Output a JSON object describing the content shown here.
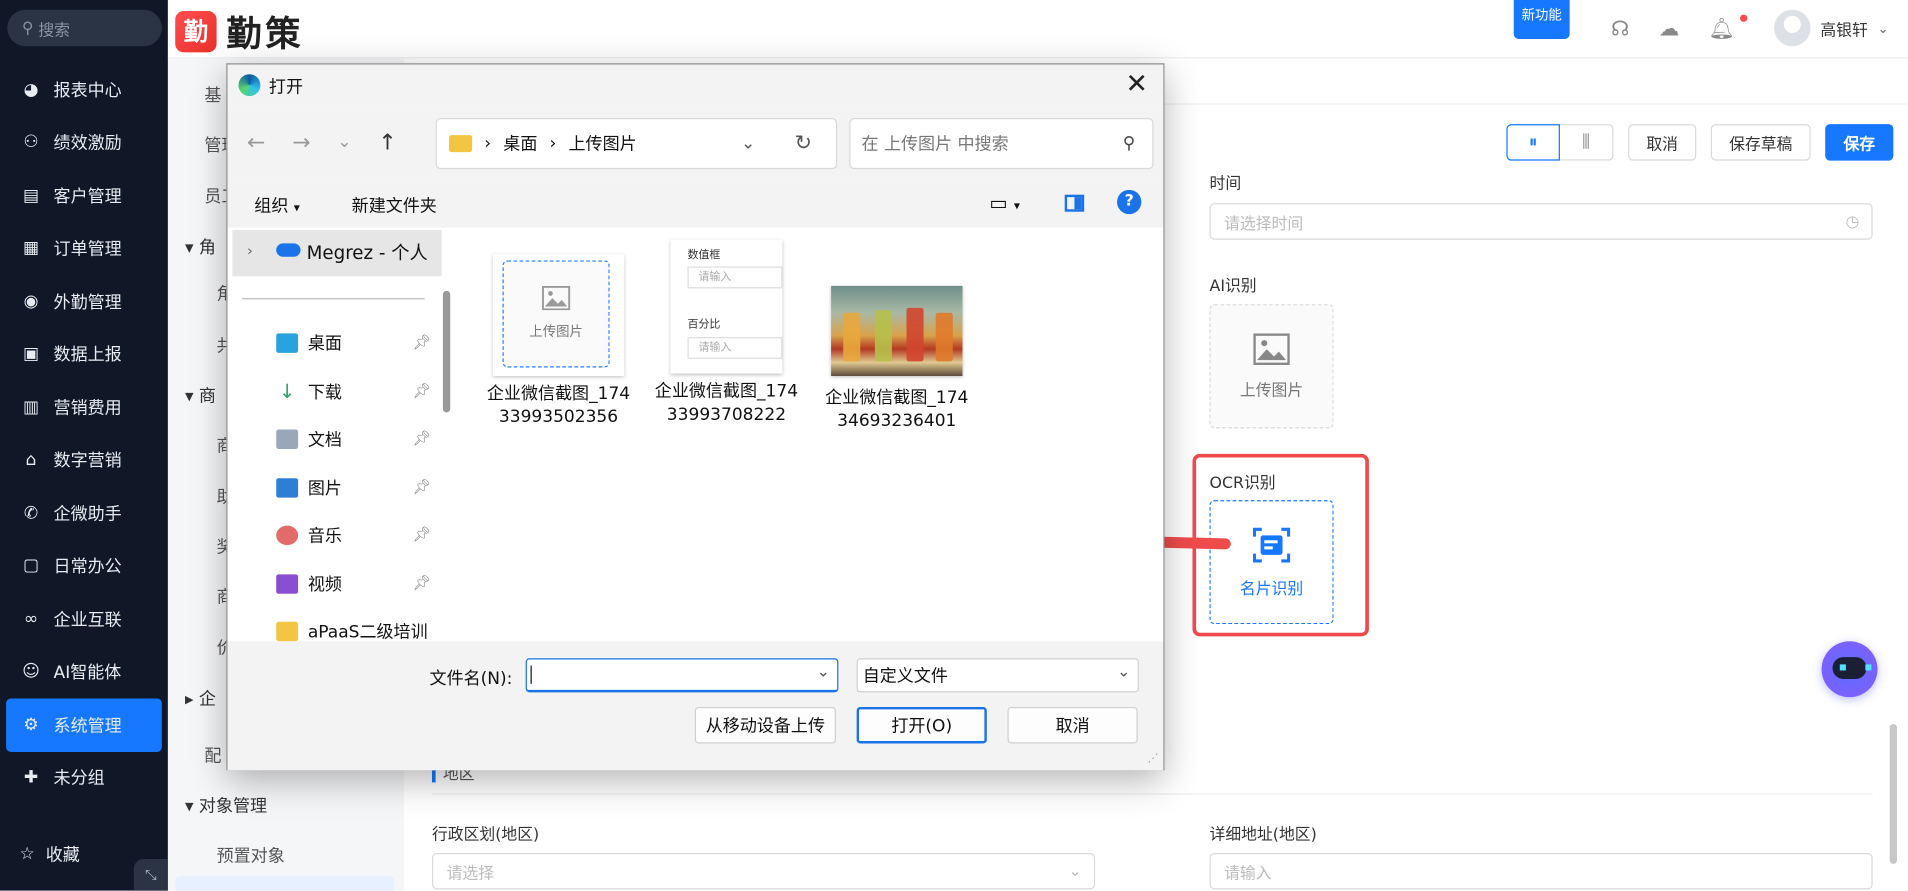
{
  "search": {
    "placeholder": "搜索"
  },
  "nav": [
    {
      "label": "报表中心",
      "icon": "pie-chart-icon"
    },
    {
      "label": "绩效激励",
      "icon": "award-icon"
    },
    {
      "label": "客户管理",
      "icon": "contacts-icon"
    },
    {
      "label": "订单管理",
      "icon": "order-icon"
    },
    {
      "label": "外勤管理",
      "icon": "location-icon"
    },
    {
      "label": "数据上报",
      "icon": "report-icon"
    },
    {
      "label": "营销费用",
      "icon": "expense-icon"
    },
    {
      "label": "数字营销",
      "icon": "store-icon"
    },
    {
      "label": "企微助手",
      "icon": "wecom-icon"
    },
    {
      "label": "日常办公",
      "icon": "briefcase-icon"
    },
    {
      "label": "企业互联",
      "icon": "link-icon"
    },
    {
      "label": "AI智能体",
      "icon": "robot-icon"
    },
    {
      "label": "系统管理",
      "icon": "gear-icon",
      "active": true
    },
    {
      "label": "未分组",
      "icon": "puzzle-icon"
    }
  ],
  "favorites": "收藏",
  "brand": {
    "mark": "勤",
    "name": "勤策"
  },
  "topbar": {
    "new_feature": "新功能",
    "user": "高银轩"
  },
  "subnav": {
    "items": [
      "基",
      "管理",
      "员工",
      "角",
      "角",
      "共",
      "商",
      "商",
      "助",
      "奖",
      "商",
      "价",
      "企",
      "配",
      "对象管理",
      "预置对象"
    ],
    "groups": [
      "角色",
      "商品",
      "企业",
      "对象管理"
    ]
  },
  "toolbar": {
    "cancel": "取消",
    "save_draft": "保存草稿",
    "save": "保存"
  },
  "form": {
    "time_label": "时间",
    "time_placeholder": "请选择时间",
    "ai_label": "AI识别",
    "ai_upload": "上传图片",
    "ocr_label": "OCR识别",
    "ocr_button": "名片识别",
    "section": "地区",
    "region_label": "行政区划(地区)",
    "region_placeholder": "请选择",
    "address_label": "详细地址(地区)",
    "address_placeholder": "请输入"
  },
  "dialog": {
    "title": "打开",
    "path": [
      "桌面",
      "上传图片"
    ],
    "search_placeholder": "在 上传图片 中搜索",
    "organize": "组织",
    "new_folder": "新建文件夹",
    "help": "?",
    "tree_root": "Megrez - 个人",
    "tree": [
      {
        "label": "桌面",
        "icon": "desktop-icon"
      },
      {
        "label": "下载",
        "icon": "download-icon"
      },
      {
        "label": "文档",
        "icon": "document-icon"
      },
      {
        "label": "图片",
        "icon": "pictures-icon"
      },
      {
        "label": "音乐",
        "icon": "music-icon"
      },
      {
        "label": "视频",
        "icon": "video-icon"
      },
      {
        "label": "aPaaS二级培训",
        "icon": "folder-icon"
      }
    ],
    "files": [
      {
        "name": "企业微信截图_17433993502356",
        "thumb_text": "上传图片"
      },
      {
        "name": "企业微信截图_17433993708222",
        "thumb_labels": [
          "数值框",
          "请输入",
          "百分比",
          "请输入"
        ]
      },
      {
        "name": "企业微信截图_17434693236401",
        "thumb_text": ""
      }
    ],
    "filename_label": "文件名(N):",
    "filetype": "自定义文件",
    "upload_mobile": "从移动设备上传",
    "open": "打开(O)",
    "cancel": "取消"
  },
  "colors": {
    "accent": "#1677ff",
    "highlight": "#f04b4b",
    "sidebar": "#101828"
  }
}
